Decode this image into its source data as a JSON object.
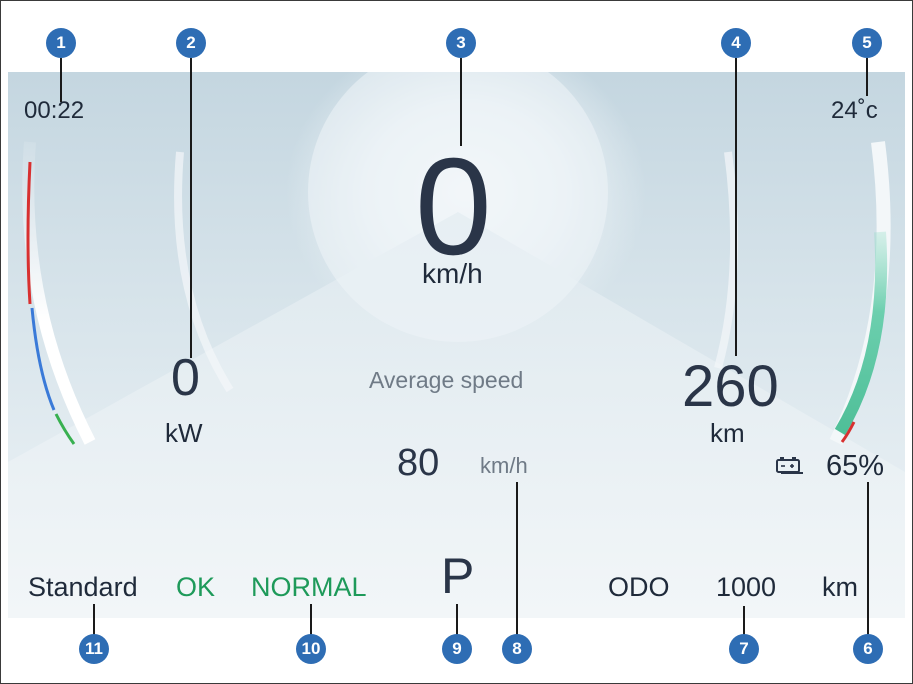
{
  "cluster": {
    "time": "00:22",
    "temperature": "24˚c",
    "speed_value": "0",
    "speed_unit": "km/h",
    "power_value": "0",
    "power_unit": "kW",
    "average_speed_label": "Average speed",
    "average_speed_value": "80",
    "average_speed_unit": "km/h",
    "range_value": "260",
    "range_unit": "km",
    "battery_percent": "65%",
    "battery_level": 0.65,
    "drive_mode": "Standard",
    "status_ok": "OK",
    "status_normal": "NORMAL",
    "gear": "P",
    "odo_label": "ODO",
    "odo_value": "1000",
    "odo_unit": "km"
  },
  "callouts": [
    "1",
    "2",
    "3",
    "4",
    "5",
    "6",
    "7",
    "8",
    "9",
    "10",
    "11"
  ],
  "colors": {
    "text": "#1f2a3a",
    "status_green": "#1e9a5a",
    "callout_blue": "#2e6db4",
    "battery_arc": "#5cc8a8",
    "warn_red": "#d83030",
    "power_blue": "#3a7ad8",
    "power_green": "#38b050"
  }
}
